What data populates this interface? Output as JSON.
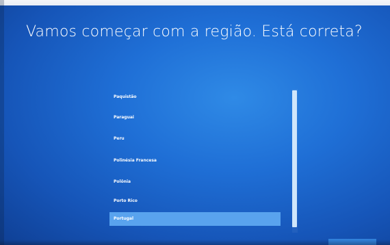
{
  "title": "Vamos começar com a região. Está correta?",
  "regions": [
    {
      "label": "Paquistão",
      "selected": false
    },
    {
      "label": "Paraguai",
      "selected": false
    },
    {
      "label": "Peru",
      "selected": false
    },
    {
      "label": "Polinésia Francesa",
      "selected": false
    },
    {
      "label": "Polônia",
      "selected": false
    },
    {
      "label": "Porto Rico",
      "selected": false
    },
    {
      "label": "Portugal",
      "selected": true
    }
  ],
  "colors": {
    "background": "#1f6fd6",
    "selection": "#59a3ee",
    "scrollbar": "#cfe6fb"
  }
}
